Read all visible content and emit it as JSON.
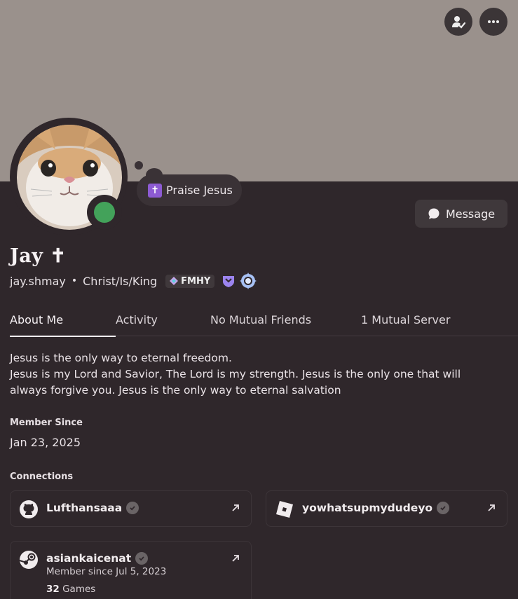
{
  "banner": {
    "color": "#9a918c"
  },
  "actions": {
    "icons": [
      "add-friend-icon",
      "more-options-icon"
    ]
  },
  "profile": {
    "status_color": "#43a25a",
    "custom_status": {
      "emoji": "✝",
      "text": "Praise Jesus"
    },
    "message_label": "Message",
    "display_name": "Jay ✝",
    "username": "jay.shmay",
    "pronouns": "Christ/Is/King",
    "clan_tag": "FMHY"
  },
  "tabs": [
    {
      "label": "About Me",
      "active": true
    },
    {
      "label": "Activity",
      "active": false
    },
    {
      "label": "No Mutual Friends",
      "active": false
    },
    {
      "label": "1 Mutual Server",
      "active": false
    }
  ],
  "about": {
    "bio_line1": "Jesus is the only way to eternal freedom.",
    "bio_line2": "Jesus is my Lord and Savior, The Lord is my strength. Jesus is the only one that will always forgive you. Jesus is the only way to eternal salvation",
    "member_since_label": "Member Since",
    "member_since_value": "Jan 23, 2025",
    "connections_label": "Connections"
  },
  "connections": [
    {
      "service": "github",
      "name": "Lufthansaaa",
      "verified": true
    },
    {
      "service": "roblox",
      "name": "yowhatsupmydudeyo",
      "verified": true
    },
    {
      "service": "steam",
      "name": "asiankaicenat",
      "verified": true,
      "member_since": "Member since Jul 5, 2023",
      "games_count": "32",
      "games_label": "Games"
    }
  ]
}
